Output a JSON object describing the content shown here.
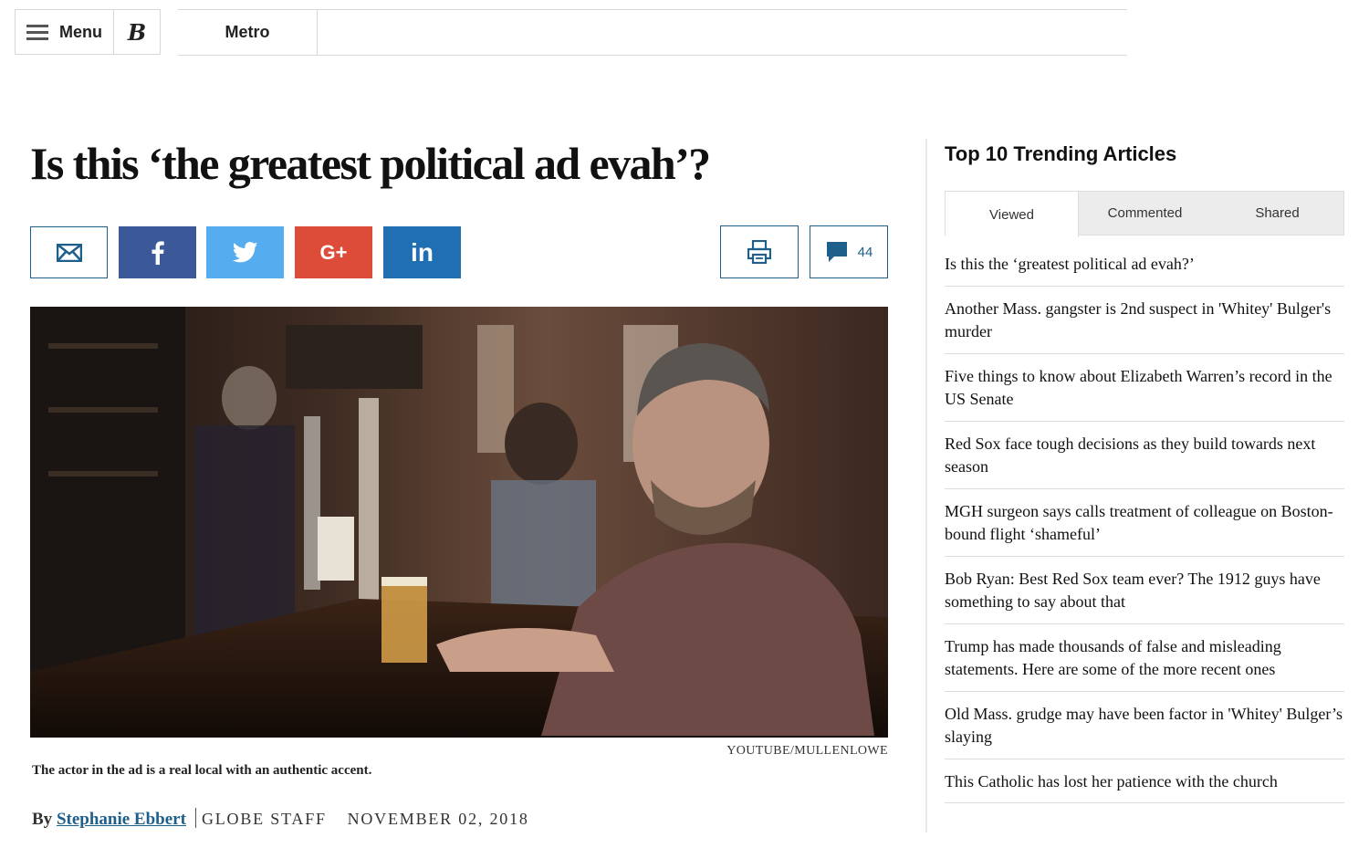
{
  "nav": {
    "menu_label": "Menu",
    "logo": "B",
    "section": "Metro"
  },
  "article": {
    "headline": "Is this ‘the greatest political ad evah’?",
    "comment_count": "44",
    "share": {
      "gplus_label": "G+",
      "linkedin_label": "in"
    },
    "photo_credit": "YOUTUBE/MULLENLOWE",
    "caption": "The actor in the ad is a real local with an authentic accent.",
    "byline": {
      "prefix": "By",
      "author": "Stephanie Ebbert",
      "staff": "GLOBE STAFF",
      "date": "NOVEMBER 02, 2018"
    }
  },
  "sidebar": {
    "title": "Top 10 Trending Articles",
    "tabs": [
      {
        "label": "Viewed",
        "active": true
      },
      {
        "label": "Commented",
        "active": false
      },
      {
        "label": "Shared",
        "active": false
      }
    ],
    "articles": [
      "Is this the ‘greatest political ad evah?’",
      "Another Mass. gangster is 2nd suspect in 'Whitey' Bulger's murder",
      "Five things to know about Elizabeth Warren’s record in the US Senate",
      "Red Sox face tough decisions as they build towards next season",
      "MGH surgeon says calls treatment of colleague on Boston-bound flight ‘shameful’",
      "Bob Ryan: Best Red Sox team ever? The 1912 guys have something to say about that",
      "Trump has made thousands of false and misleading statements. Here are some of the more recent ones",
      "Old Mass. grudge may have been factor in 'Whitey' Bulger’s slaying",
      "This Catholic has lost her patience with the church"
    ]
  }
}
